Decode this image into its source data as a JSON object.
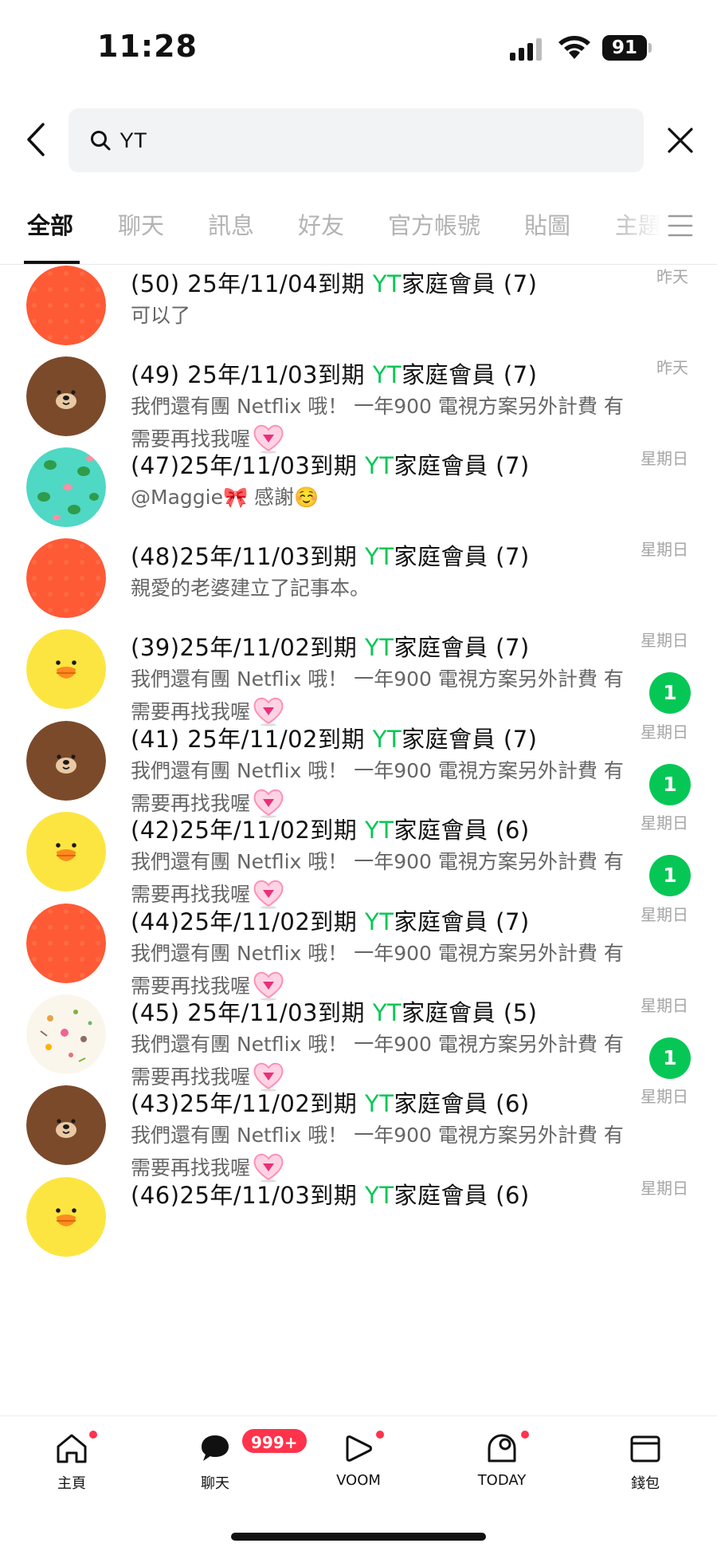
{
  "status_bar": {
    "time": "11:28",
    "battery": "91"
  },
  "search": {
    "query": "YT"
  },
  "tabs": [
    {
      "label": "全部"
    },
    {
      "label": "聊天"
    },
    {
      "label": "訊息"
    },
    {
      "label": "好友"
    },
    {
      "label": "官方帳號"
    },
    {
      "label": "貼圖"
    },
    {
      "label": "主題"
    }
  ],
  "results": [
    {
      "prefix": "(50) 25年/11/04到期 ",
      "keyword": "YT",
      "suffix": "家庭會員 (7)",
      "message": "可以了",
      "time": "昨天",
      "avatar": "orange-pattern",
      "unread": ""
    },
    {
      "prefix": "(49) 25年/11/03到期 ",
      "keyword": "YT",
      "suffix": "家庭會員 (7)",
      "message": "我們還有團 Netflix 哦！ 一年900 電視方案另外計費 有需要再找我喔",
      "time": "昨天",
      "avatar": "brown-bear",
      "unread": ""
    },
    {
      "prefix": "(47)25年/11/03到期 ",
      "keyword": "YT",
      "suffix": "家庭會員 (7)",
      "message": "@Maggie🎀 感謝☺️",
      "time": "星期日",
      "avatar": "frog-pattern",
      "unread": ""
    },
    {
      "prefix": "(48)25年/11/03到期 ",
      "keyword": "YT",
      "suffix": "家庭會員 (7)",
      "message": "親愛的老婆建立了記事本。",
      "time": "星期日",
      "avatar": "orange-pattern",
      "unread": ""
    },
    {
      "prefix": "(39)25年/11/02到期 ",
      "keyword": "YT",
      "suffix": "家庭會員 (7)",
      "message": "我們還有團 Netflix 哦！ 一年900 電視方案另外計費 有需要再找我喔",
      "time": "星期日",
      "avatar": "yellow-chick",
      "unread": "1"
    },
    {
      "prefix": "(41) 25年/11/02到期 ",
      "keyword": "YT",
      "suffix": "家庭會員 (7)",
      "message": "我們還有團 Netflix 哦！ 一年900 電視方案另外計費 有需要再找我喔",
      "time": "星期日",
      "avatar": "brown-bear",
      "unread": "1"
    },
    {
      "prefix": "(42)25年/11/02到期 ",
      "keyword": "YT",
      "suffix": "家庭會員 (6)",
      "message": "我們還有團 Netflix 哦！ 一年900 電視方案另外計費 有需要再找我喔",
      "time": "星期日",
      "avatar": "yellow-chick",
      "unread": "1"
    },
    {
      "prefix": "(44)25年/11/02到期 ",
      "keyword": "YT",
      "suffix": "家庭會員 (7)",
      "message": "我們還有團 Netflix 哦！ 一年900 電視方案另外計費 有需要再找我喔",
      "time": "星期日",
      "avatar": "orange-pattern",
      "unread": ""
    },
    {
      "prefix": "(45) 25年/11/03到期 ",
      "keyword": "YT",
      "suffix": "家庭會員 (5)",
      "message": "我們還有團 Netflix 哦！ 一年900 電視方案另外計費 有需要再找我喔",
      "time": "星期日",
      "avatar": "food-illustration",
      "unread": "1"
    },
    {
      "prefix": "(43)25年/11/02到期 ",
      "keyword": "YT",
      "suffix": "家庭會員 (6)",
      "message": "我們還有團 Netflix 哦！ 一年900 電視方案另外計費 有需要再找我喔",
      "time": "星期日",
      "avatar": "brown-bear",
      "unread": ""
    },
    {
      "prefix": "(46)25年/11/03到期 ",
      "keyword": "YT",
      "suffix": "家庭會員 (6)",
      "message": "",
      "time": "星期日",
      "avatar": "yellow-chick",
      "unread": ""
    }
  ],
  "bottom_nav": [
    {
      "label": "主頁",
      "icon": "home-icon",
      "dot": true,
      "badge": ""
    },
    {
      "label": "聊天",
      "icon": "chat-icon",
      "dot": false,
      "badge": "999+"
    },
    {
      "label": "VOOM",
      "icon": "voom-icon",
      "dot": true,
      "badge": ""
    },
    {
      "label": "TODAY",
      "icon": "today-icon",
      "dot": true,
      "badge": ""
    },
    {
      "label": "錢包",
      "icon": "wallet-icon",
      "dot": false,
      "badge": ""
    }
  ],
  "colors": {
    "accent": "#06c755",
    "badge": "#ff334b",
    "orange": "#ff5a36",
    "bear": "#7b4a2a",
    "chick": "#fde541",
    "frog_bg": "#4fd8c4"
  }
}
